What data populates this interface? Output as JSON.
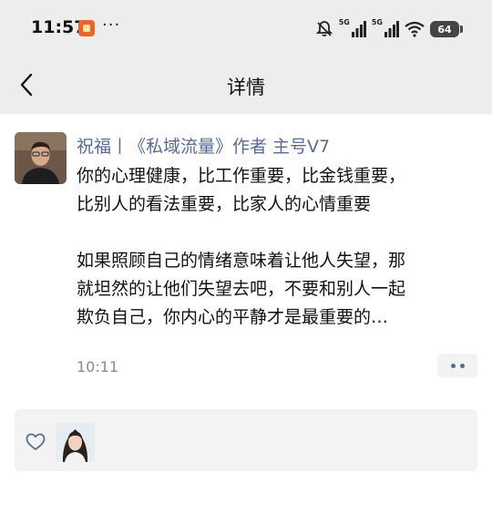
{
  "status_bar": {
    "time": "11:57",
    "app_icon": "app-badge-icon",
    "more": "···",
    "network1": "5G",
    "network2": "5G",
    "battery": "64"
  },
  "nav": {
    "back_icon": "chevron-left-icon",
    "title": "详情"
  },
  "post": {
    "author": "祝福丨《私域流量》作者 主号V7",
    "lines": [
      "你的心理健康，比工作重要，比金钱重要，",
      "比别人的看法重要，比家人的心情重要",
      "如果照顾自己的情绪意味着让他人失望，那",
      "就坦然的让他们失望去吧，不要和别人一起",
      "欺负自己，你内心的平静才是最重要的…"
    ],
    "time": "10:11",
    "more_icon": "more-dots-icon"
  },
  "likes": {
    "icon": "heart-icon"
  },
  "colors": {
    "header_bg": "#ededed",
    "author_link": "#576b95",
    "panel_bg": "#f3f3f3"
  }
}
